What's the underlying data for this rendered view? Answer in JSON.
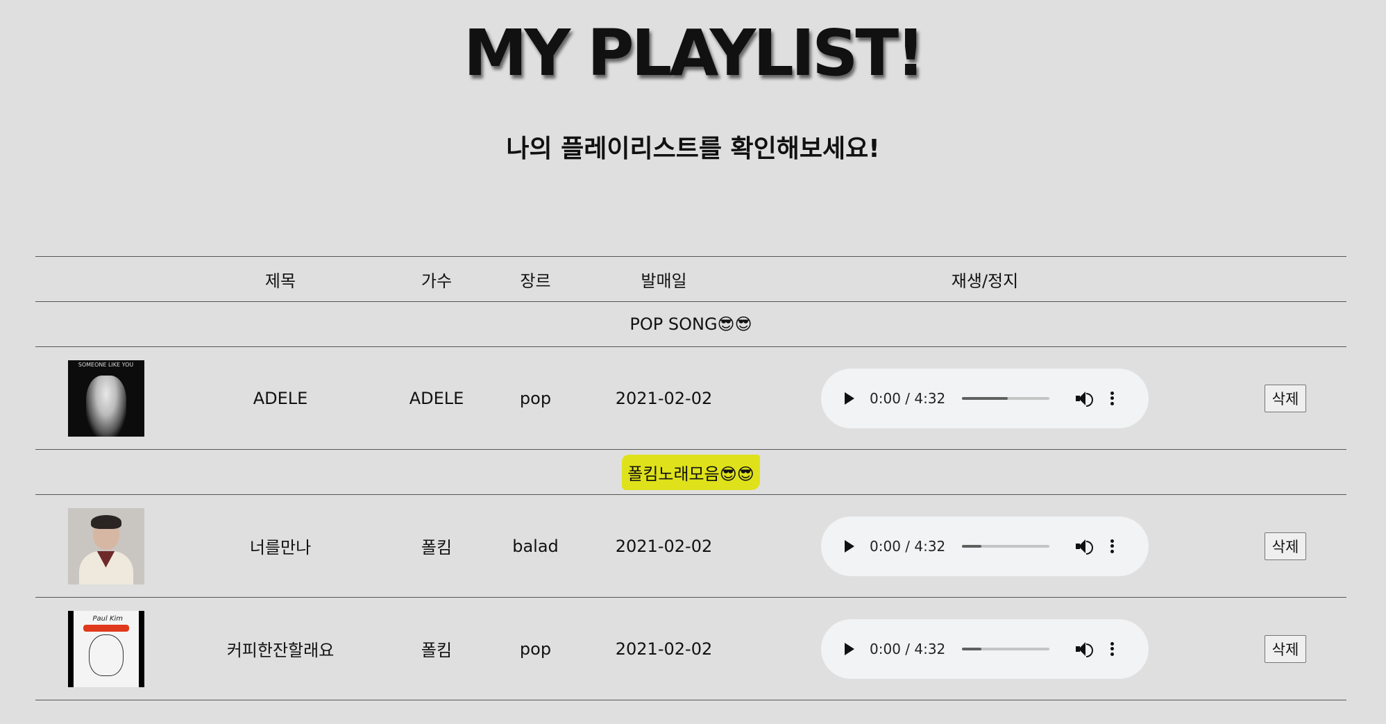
{
  "header": {
    "title": "MY PLAYLIST!",
    "subtitle": "나의 플레이리스트를 확인해보세요!"
  },
  "table": {
    "columns": [
      "",
      "제목",
      "가수",
      "장르",
      "발매일",
      "재생/정지",
      ""
    ],
    "groups": [
      {
        "label": "POP SONG😎😎",
        "highlight": false,
        "songs": [
          {
            "cover_icon": "album-cover-someone-like-you",
            "cover_caption": "SOMEONE LIKE YOU",
            "title": "ADELE",
            "artist": "ADELE",
            "genre": "pop",
            "release": "2021-02-02",
            "time": "0:00 / 4:32",
            "progress": 0.52,
            "delete_label": "삭제"
          }
        ]
      },
      {
        "label": "폴킴노래모음😎😎",
        "highlight": true,
        "highlight_color": "#dfe21a",
        "songs": [
          {
            "cover_icon": "album-cover-portrait",
            "title": "너를만나",
            "artist": "폴킴",
            "genre": "balad",
            "release": "2021-02-02",
            "time": "0:00 / 4:32",
            "progress": 0.22,
            "delete_label": "삭제"
          },
          {
            "cover_icon": "album-cover-sketch",
            "cover_caption": "Paul Kim",
            "title": "커피한잔할래요",
            "artist": "폴킴",
            "genre": "pop",
            "release": "2021-02-02",
            "time": "0:00 / 4:32",
            "progress": 0.22,
            "delete_label": "삭제"
          }
        ]
      }
    ]
  },
  "colors": {
    "background": "#e0dfdf",
    "player_background": "#f1f3f4",
    "progress_fill": "#5f5f5f",
    "rule": "#555555"
  }
}
